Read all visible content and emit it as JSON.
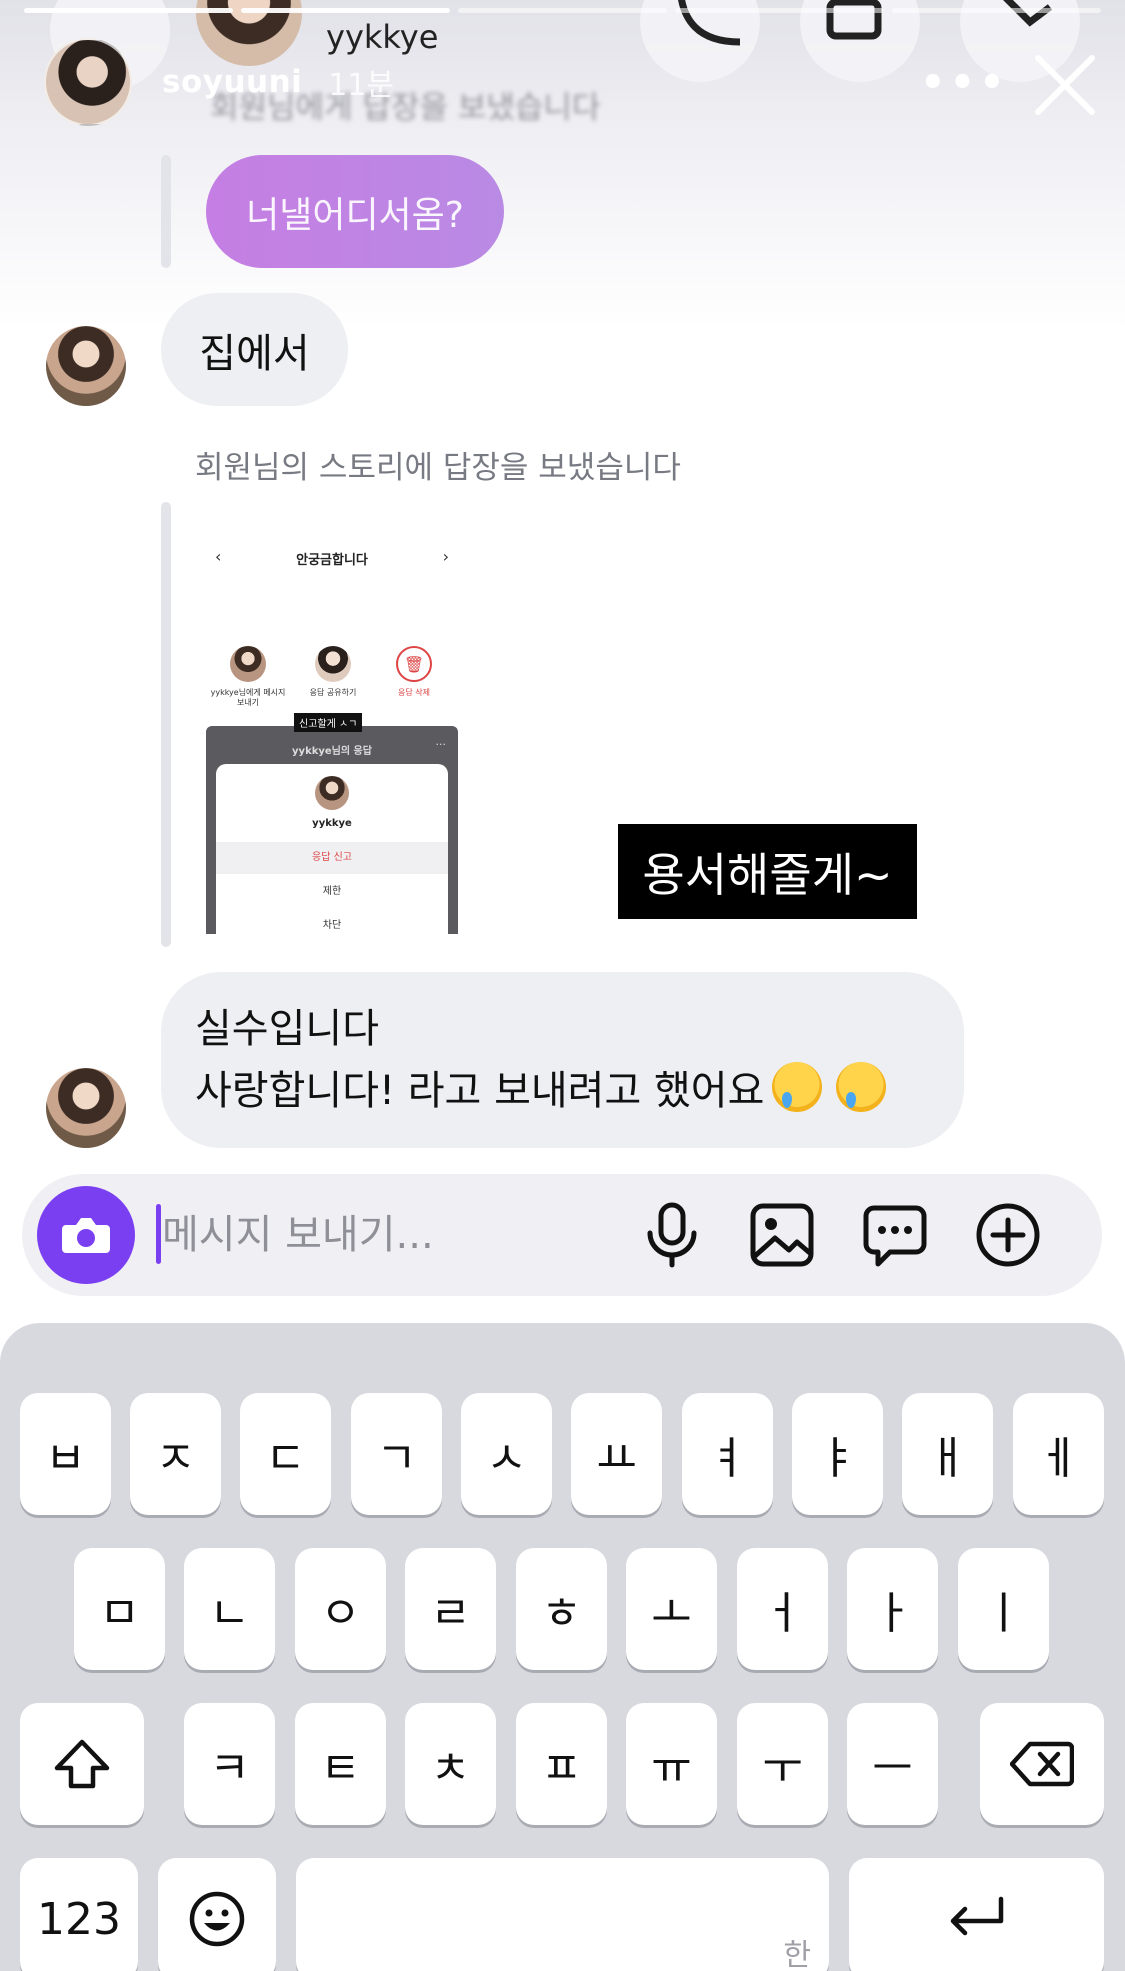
{
  "story": {
    "username": "soyuuni",
    "time": "11분",
    "more_label": "•••",
    "behind_title": "yykkye",
    "behind_notice": "회원님에게 답장을 보냈습니다"
  },
  "chat": {
    "outgoing_message": "너낼어디서옴?",
    "incoming_home": "집에서",
    "system_notice": "회원님의 스토리에 답장을 보냈습니다",
    "shared_story": {
      "title": "안궁금합니다",
      "action_1": "yykkye님에게 메시지 보내기",
      "action_2": "응답 공유하기",
      "action_3": "응답 삭제",
      "tooltip": "신고할게 ㅅㄱ",
      "sheet_title": "yykkye님의 응답",
      "profile_name": "yykkye",
      "option_report": "응답 신고",
      "option_restrict": "제한",
      "option_block": "차단"
    },
    "sticker_text": "용서해줄게~",
    "incoming_long_line1": "실수입니다",
    "incoming_long_line2": "사랑합니다! 라고 보내려고 했어요"
  },
  "composer": {
    "placeholder": "메시지 보내기...",
    "accent_color": "#7b3ff2"
  },
  "keyboard": {
    "row1": [
      "ㅂ",
      "ㅈ",
      "ㄷ",
      "ㄱ",
      "ㅅ",
      "ㅛ",
      "ㅕ",
      "ㅑ",
      "ㅐ",
      "ㅔ"
    ],
    "row2": [
      "ㅁ",
      "ㄴ",
      "ㅇ",
      "ㄹ",
      "ㅎ",
      "ㅗ",
      "ㅓ",
      "ㅏ",
      "ㅣ"
    ],
    "row3": [
      "ㅋ",
      "ㅌ",
      "ㅊ",
      "ㅍ",
      "ㅠ",
      "ㅜ",
      "ㅡ"
    ],
    "numbers_key": "123",
    "space_hint": "한"
  }
}
